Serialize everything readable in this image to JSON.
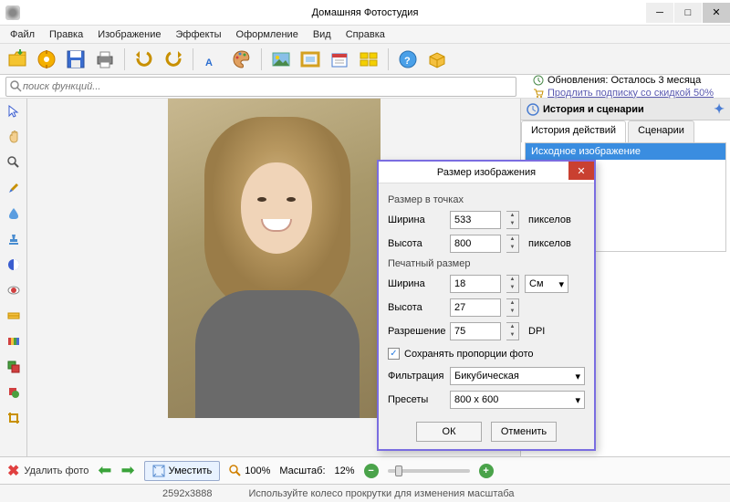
{
  "window": {
    "title": "Домашняя Фотостудия"
  },
  "menu": {
    "file": "Файл",
    "edit": "Правка",
    "image": "Изображение",
    "effects": "Эффекты",
    "design": "Оформление",
    "view": "Вид",
    "help": "Справка"
  },
  "search": {
    "placeholder": "поиск функций..."
  },
  "updates": {
    "remaining": "Обновления: Осталось  3 месяца",
    "extend": "Продлить подписку со скидкой 50%"
  },
  "panel": {
    "title": "История и сценарии",
    "tab_history": "История действий",
    "tab_scripts": "Сценарии",
    "history_item": "Исходное изображение"
  },
  "dialog": {
    "title": "Размер изображения",
    "group_pixels": "Размер в точках",
    "width_label": "Ширина",
    "width_value": "533",
    "height_label": "Высота",
    "height_value": "800",
    "pixels_unit": "пикселов",
    "group_print": "Печатный размер",
    "print_width": "18",
    "print_height": "27",
    "print_unit": "См",
    "res_label": "Разрешение",
    "res_value": "75",
    "res_unit": "DPI",
    "keep_ratio": "Сохранять пропорции фото",
    "filter_label": "Фильтрация",
    "filter_value": "Бикубическая",
    "preset_label": "Пресеты",
    "preset_value": "800 x 600",
    "ok": "ОК",
    "cancel": "Отменить"
  },
  "bottom": {
    "delete": "Удалить фото",
    "fit": "Уместить",
    "hundred": "100%",
    "scale_label": "Масштаб:",
    "scale_value": "12%"
  },
  "status": {
    "dims": "2592x3888",
    "hint": "Используйте колесо прокрутки для изменения масштаба"
  }
}
